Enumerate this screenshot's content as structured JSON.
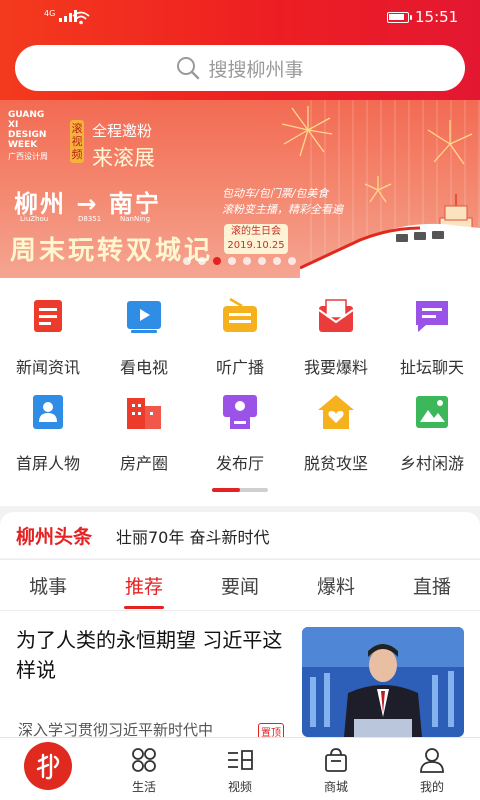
{
  "status": {
    "network": "4G",
    "time": "15:51"
  },
  "search": {
    "placeholder": "搜搜柳州事"
  },
  "banner": {
    "brand_lines": [
      "GUANG",
      "XI",
      "DESIGN",
      "WEEK"
    ],
    "brand_sub": "广西设计周",
    "badge": "滚视频",
    "line1": "全程邀粉",
    "line2": "来滚展",
    "route": "柳州 → 南宁",
    "route_from": "LiuZhou",
    "route_train": "D8351",
    "route_to": "NanNing",
    "headline": "周末玩转双城记",
    "side1": "包动车/包门票/包美食",
    "side2": "滚粉变主播，精彩全看遍",
    "bday_title": "滚的生日会",
    "bday_date": "2019.10.25",
    "dots": 8,
    "active_dot": 2,
    "colors": {
      "bg": "#f36a52"
    }
  },
  "grid": [
    {
      "label": "新闻资讯",
      "icon": "news-icon",
      "color": "#ec3b2a"
    },
    {
      "label": "看电视",
      "icon": "tv-icon",
      "color": "#2f8de6"
    },
    {
      "label": "听广播",
      "icon": "radio-icon",
      "color": "#f5b21c"
    },
    {
      "label": "我要爆料",
      "icon": "mail-icon",
      "color": "#ec3b3b"
    },
    {
      "label": "扯坛聊天",
      "icon": "chat-icon",
      "color": "#9b52e6"
    },
    {
      "label": "首屏人物",
      "icon": "person-card-icon",
      "color": "#2f8de6"
    },
    {
      "label": "房产圈",
      "icon": "building-icon",
      "color": "#ec3b2a"
    },
    {
      "label": "发布厅",
      "icon": "podium-icon",
      "color": "#9b52e6"
    },
    {
      "label": "脱贫攻坚",
      "icon": "house-heart-icon",
      "color": "#f5b21c"
    },
    {
      "label": "乡村闲游",
      "icon": "map-icon",
      "color": "#3cb85a"
    }
  ],
  "headline_bar": {
    "brand": "柳州头条",
    "text": "壮丽70年 奋斗新时代"
  },
  "tabs": [
    {
      "label": "城事",
      "active": false
    },
    {
      "label": "推荐",
      "active": true
    },
    {
      "label": "要闻",
      "active": false
    },
    {
      "label": "爆料",
      "active": false
    },
    {
      "label": "直播",
      "active": false
    }
  ],
  "article": {
    "title": "为了人类的永恒期望 习近平这样说",
    "subtitle": "深入学习贯彻习近平新时代中",
    "tag": "置顶"
  },
  "nav": [
    {
      "label": "",
      "icon": "home-logo-icon"
    },
    {
      "label": "生活",
      "icon": "apps-icon"
    },
    {
      "label": "视频",
      "icon": "video-list-icon"
    },
    {
      "label": "商城",
      "icon": "shopping-bag-icon"
    },
    {
      "label": "我的",
      "icon": "user-icon"
    }
  ]
}
